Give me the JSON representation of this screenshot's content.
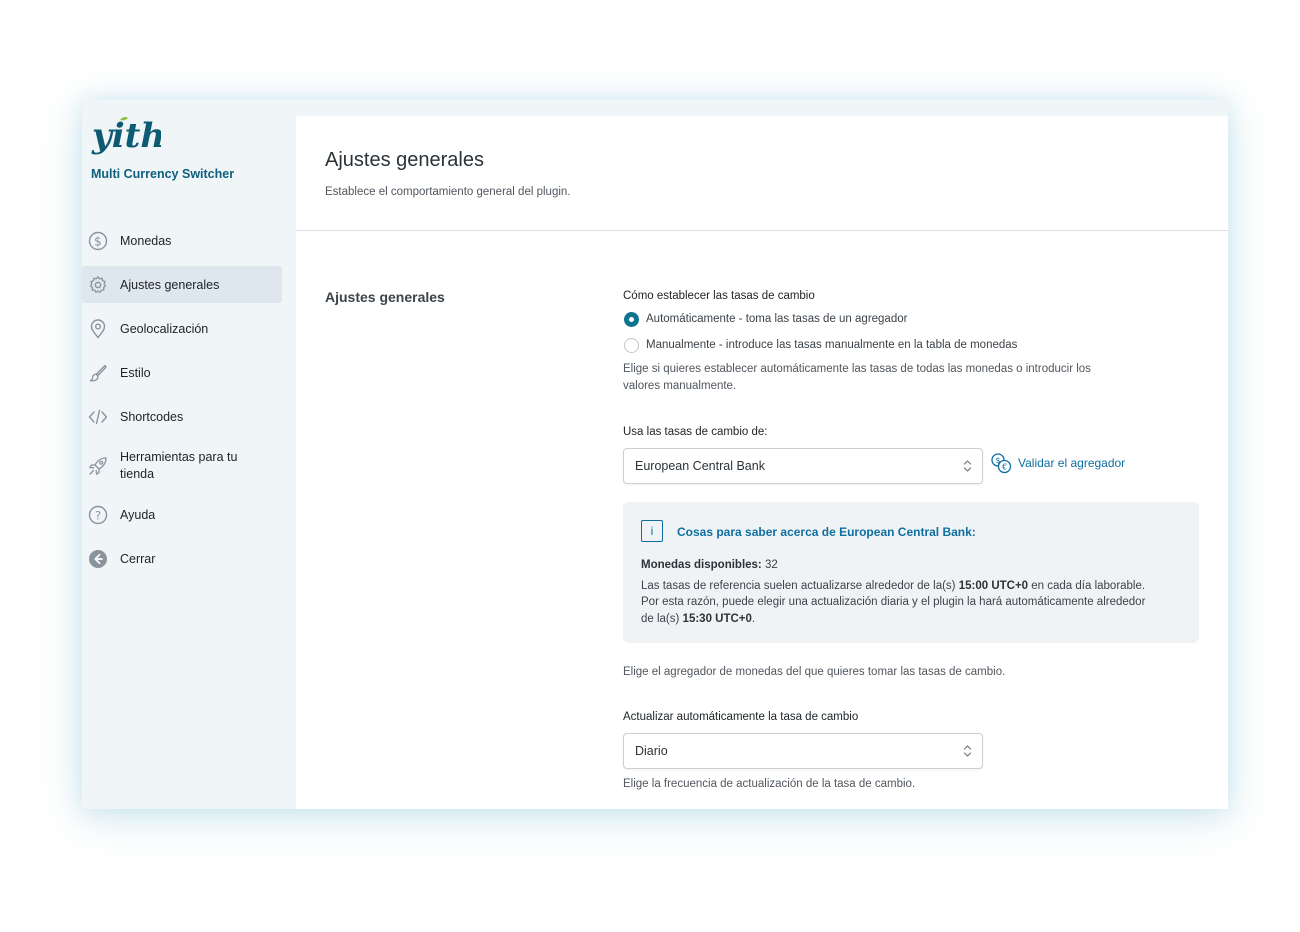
{
  "colors": {
    "accent": "#0e7490",
    "link": "#0e6fa0",
    "sidebar_bg": "#f0f5f8",
    "active_bg": "#dfe7ee",
    "logo_green": "#8dbf3a"
  },
  "sidebar": {
    "logo_text": "yith",
    "plugin_name": "Multi Currency Switcher",
    "items": [
      {
        "label": "Monedas",
        "icon": "dollar-circle-icon"
      },
      {
        "label": "Ajustes generales",
        "icon": "gear-icon",
        "active": true
      },
      {
        "label": "Geolocalización",
        "icon": "map-pin-icon"
      },
      {
        "label": "Estilo",
        "icon": "brush-icon"
      },
      {
        "label": "Shortcodes",
        "icon": "code-icon"
      },
      {
        "label": "Herramientas para tu tienda",
        "icon": "rocket-icon"
      },
      {
        "label": "Ayuda",
        "icon": "help-circle-icon"
      },
      {
        "label": "Cerrar",
        "icon": "arrow-left-circle-icon"
      }
    ]
  },
  "header": {
    "title": "Ajustes generales",
    "description": "Establece el comportamiento general del plugin."
  },
  "section": {
    "title": "Ajustes generales"
  },
  "rates_method": {
    "label": "Cómo establecer las tasas de cambio",
    "options": [
      "Automáticamente - toma las tasas de un agregador",
      "Manualmente - introduce las tasas manualmente en la tabla de monedas"
    ],
    "selected": 0,
    "help_line1": "Elige si quieres establecer automáticamente las tasas de todas las monedas o introducir los",
    "help_line2": "valores manualmente."
  },
  "aggregator": {
    "label": "Usa las tasas de cambio de:",
    "value": "European Central Bank",
    "validate_label": "Validar el agregador",
    "validate_icon": "currency-exchange-icon",
    "help": "Elige el agregador de monedas del que quieres tomar las tasas de cambio."
  },
  "info": {
    "icon": "info-icon",
    "icon_glyph": "i",
    "title": "Cosas para saber acerca de European Central Bank:",
    "available_label": "Monedas disponibles:",
    "available_count": "32",
    "text1_before": "Las tasas de referencia suelen actualizarse alrededor de la(s) ",
    "time1": "15:00 UTC+0",
    "text1_after": " en cada día laborable.",
    "text2": "Por esta razón, puede elegir una actualización diaria y el plugin la hará automáticamente alrededor",
    "text3_before": "de la(s) ",
    "time2": "15:30 UTC+0",
    "text3_after": "."
  },
  "auto_update": {
    "label": "Actualizar automáticamente la tasa de cambio",
    "value": "Diario",
    "help": "Elige la frecuencia de actualización de la tasa de cambio."
  }
}
